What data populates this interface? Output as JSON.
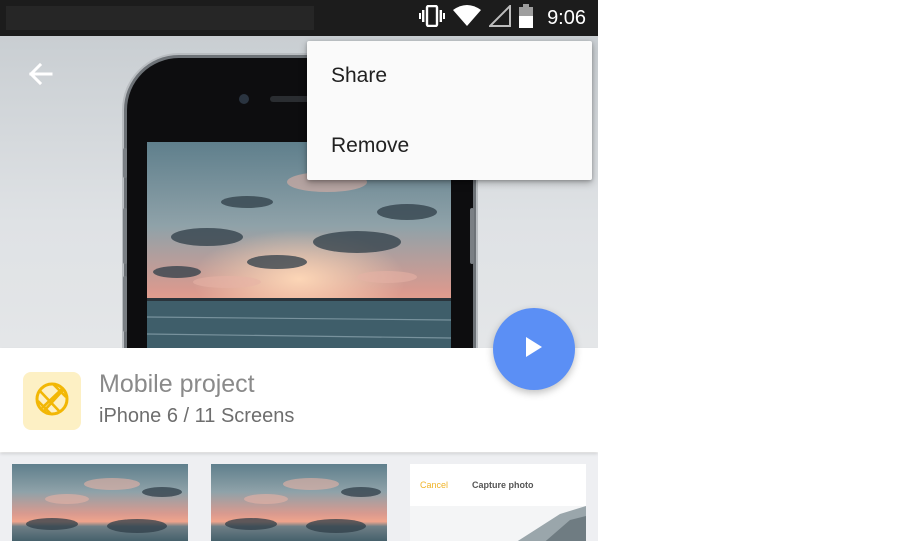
{
  "status_bar": {
    "time": "9:06",
    "icons": [
      "vibrate-icon",
      "wifi-icon",
      "signal-icon",
      "battery-icon"
    ]
  },
  "toolbar": {
    "back_icon": "arrow-left-icon"
  },
  "menu": {
    "items": [
      {
        "label": "Share"
      },
      {
        "label": "Remove"
      }
    ]
  },
  "project": {
    "title": "Mobile project",
    "subtitle": "iPhone 6 / 11 Screens",
    "icon": "aperture-icon"
  },
  "fab": {
    "icon": "play-icon",
    "color": "#5b8ff5"
  },
  "thumbnails": {
    "capture": {
      "cancel_label": "Cancel",
      "title": "Capture photo"
    }
  },
  "colors": {
    "accent": "#5b8ff5",
    "icon_bg": "#fdf0c4",
    "icon_fg": "#f2b705",
    "cancel": "#f0b429"
  }
}
